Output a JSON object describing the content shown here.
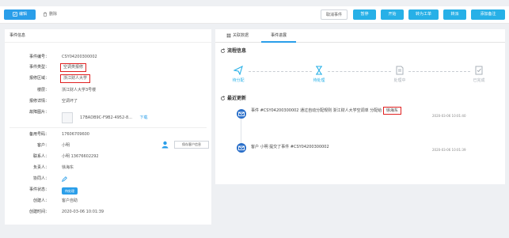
{
  "toolbar": {
    "edit_label": "编辑",
    "delete_label": "删除",
    "cancel_label": "取消事件",
    "pause_label": "暂停",
    "start_label": "开始",
    "to_work_order_label": "转为工单",
    "transfer_label": "转派",
    "add_note_label": "添加备注"
  },
  "event_info": {
    "title": "事件信息",
    "fields": {
      "id": {
        "label": "事件编号：",
        "value": "CSY04200300002"
      },
      "type": {
        "label": "事件类型：",
        "value": "空调类报修"
      },
      "area": {
        "label": "报修区域：",
        "value": "浙江财人大学"
      },
      "floor": {
        "label": "楼层：",
        "value": "浙江财人大学3号楼"
      },
      "detail": {
        "label": "报修详情：",
        "value": "空调坏了"
      },
      "attachment": {
        "label": "故障图片：",
        "filename": "17BADB9C-F9B2-4952-8...",
        "download": "下载"
      },
      "backup_phone": {
        "label": "备用号码：",
        "value": "17606709600"
      },
      "customer": {
        "label": "客户：",
        "value": "小明"
      },
      "contact": {
        "label": "联系人：",
        "value": "小明 13676602292"
      },
      "owner": {
        "label": "负责人：",
        "value": "徐海东"
      },
      "assistant": {
        "label": "协同人：",
        "value": ""
      },
      "status": {
        "label": "事件状态：",
        "value": "待处理"
      },
      "creator": {
        "label": "创建人：",
        "value": "客户自助"
      },
      "created_at": {
        "label": "创建时间：",
        "value": "2020-03-06 10:01:39"
      }
    },
    "save_customer_label": "保存客户信息"
  },
  "tabs": {
    "related": "关联数据",
    "progress": "事件进展"
  },
  "flow": {
    "title": "流程信息",
    "steps": [
      "待分配",
      "待处理",
      "处理中",
      "已完成"
    ]
  },
  "updates": {
    "title": "最近更新",
    "items": [
      {
        "text": "事件 #CSY04200300002 通过自动分配规则 浙江财人大学空调单 分配给",
        "highlight": "徐海东",
        "time": "2020-03-06 10:01:40"
      },
      {
        "text": "客户 小明 提交了事件 #CSY04200300002",
        "highlight": "",
        "time": "2020-03-06 10:01:39"
      }
    ]
  },
  "colors": {
    "primary": "#27b0e7",
    "accent": "#2a9ee9",
    "highlight_border": "#e02020",
    "timeline_icon": "#2a6fc9"
  }
}
